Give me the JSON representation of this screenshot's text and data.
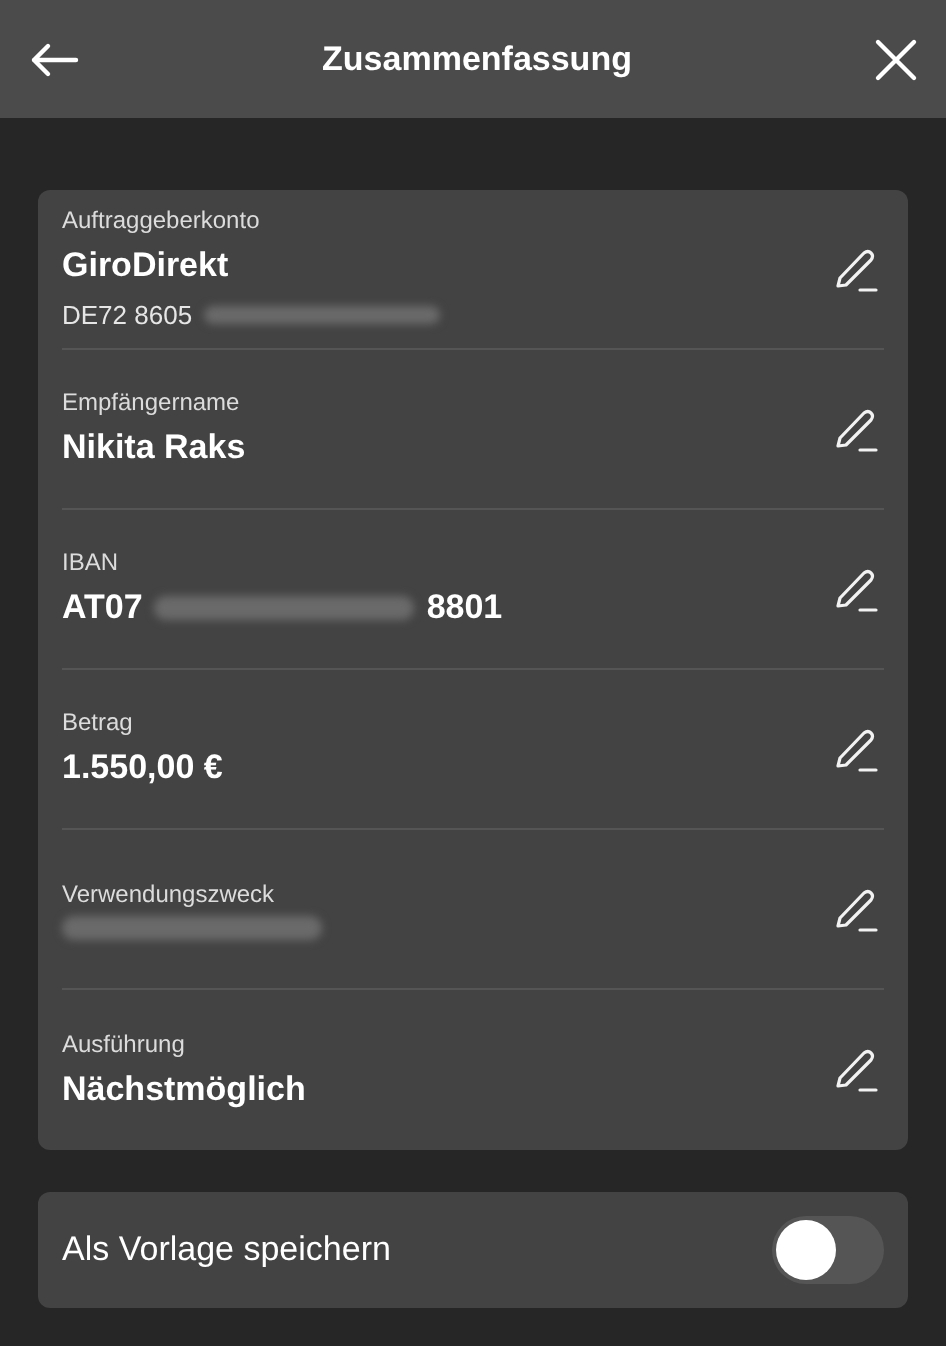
{
  "header": {
    "title": "Zusammenfassung"
  },
  "fields": [
    {
      "label": "Auftraggeberkonto",
      "value": [
        {
          "kind": "text",
          "text": "GiroDirekt"
        }
      ],
      "detail": [
        {
          "kind": "text",
          "text": "DE72 8605"
        },
        {
          "kind": "masked"
        }
      ]
    },
    {
      "label": "Empfängername",
      "value": [
        {
          "kind": "text",
          "text": "Nikita Raks"
        }
      ]
    },
    {
      "label": "IBAN",
      "value": [
        {
          "kind": "text",
          "text": "AT07"
        },
        {
          "kind": "masked"
        },
        {
          "kind": "text",
          "text": "8801"
        }
      ]
    },
    {
      "label": "Betrag",
      "value": [
        {
          "kind": "text",
          "text": "1.550,00 €"
        }
      ]
    },
    {
      "label": "Verwendungszweck",
      "value": [
        {
          "kind": "masked"
        }
      ]
    },
    {
      "label": "Ausführung",
      "value": [
        {
          "kind": "text",
          "text": "Nächstmöglich"
        }
      ]
    }
  ],
  "save_template": {
    "label": "Als Vorlage speichern",
    "on": false
  }
}
